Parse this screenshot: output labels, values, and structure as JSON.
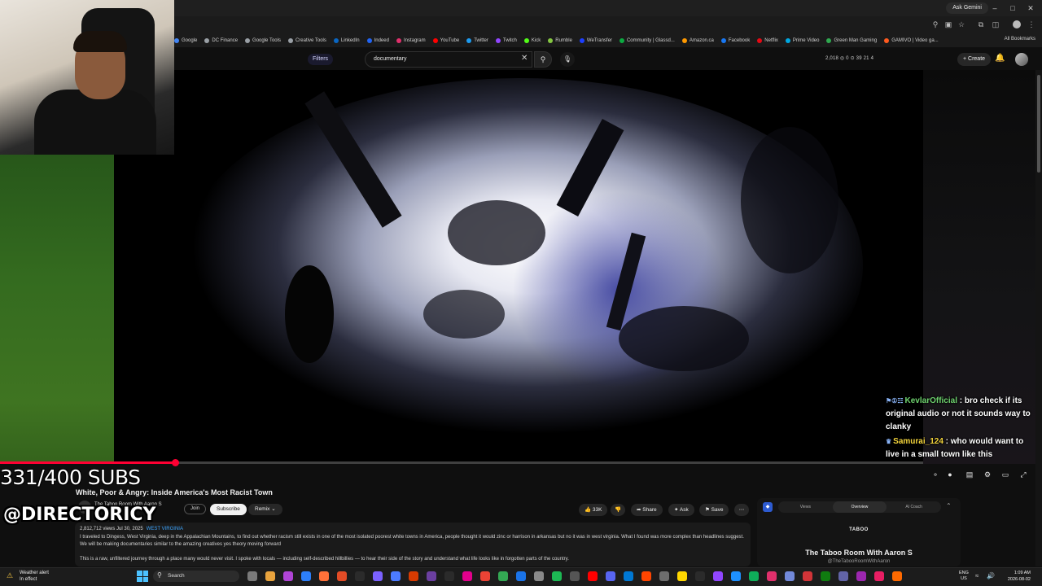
{
  "browser": {
    "ask_gemini": "Ask Gemini",
    "bookmarks": [
      "Google",
      "DC Finance",
      "Google Tools",
      "Creative Tools",
      "LinkedIn",
      "Indeed",
      "Instagram",
      "YouTube",
      "Twitter",
      "Twitch",
      "Kick",
      "Rumble",
      "WeTransfer",
      "Community | Glassd...",
      "Amazon.ca",
      "Facebook",
      "Netflix",
      "Prime Video",
      "Green Man Gaming",
      "GAMIVO | Video ga..."
    ],
    "bookmark_colors": [
      "#4285f4",
      "#9aa0a6",
      "#9aa0a6",
      "#9aa0a6",
      "#0a66c2",
      "#2164f3",
      "#e1306c",
      "#ff0000",
      "#1d9bf0",
      "#9146ff",
      "#53fc18",
      "#85c742",
      "#1c3fff",
      "#0caa41",
      "#ff9900",
      "#1877f2",
      "#e50914",
      "#00a8e1",
      "#2fa84f",
      "#ff5a1f"
    ],
    "all_bookmarks": "All Bookmarks"
  },
  "youtube": {
    "filters_label": "Filters",
    "search_value": "documentary",
    "stats_readout": "2,018  ◎ 0  ⊙ 39  21  4",
    "create_label": "+ Create"
  },
  "overlay": {
    "subs_counter": "331/400 SUBS",
    "handle": "@DIRECTORICY"
  },
  "chat": [
    {
      "user": "KevlarOfficial",
      "message": ": bro check if its original audio or not it sounds way to clanky",
      "badges": "⚑①☷",
      "color": "#6fd36f"
    },
    {
      "user": "Samurai_124",
      "message": ": who would want to live in a small town like this",
      "badges": "♛",
      "color": "#f2d33b"
    }
  ],
  "player": {
    "progress_fraction": 0.19
  },
  "video": {
    "title": "White, Poor & Angry: Inside America's Most Racist Town",
    "channel": "The Taboo Room With Aaron S",
    "join_label": "Join",
    "subscribe_label": "Subscribe",
    "remix_label": "Remix",
    "likes_label": "33K",
    "share_label": "Share",
    "ask_label": "Ask",
    "save_label": "Save",
    "more_label": "⋯",
    "views_line": "2,812,712 views  Jul 30, 2025",
    "location": "WEST VIRGINIA",
    "description_1": "I traveled to Dingess, West Virginia, deep in the Appalachian Mountains, to find out whether racism still exists in one of the most isolated poorest white towns in America, people thought it would zinc or harrison in arkansas but no it was in west virginia. What I found was more complex than headlines suggest. We will be making documentaries similar to the amazing creatives yes theory moving forward",
    "description_2": "This is a raw, unfiltered journey through a place many would never visit. I spoke with locals — including self-described hillbillies — to hear their side of the story and understand what life looks like in forgotten parts of the country."
  },
  "side_panel": {
    "tabs": [
      "Views",
      "Overview",
      "AI Coach"
    ],
    "active_tab": "Overview",
    "brand": "TABOO",
    "channel_name": "The Taboo Room With Aaron S",
    "handle": "@TheTabooRoomWithAaron"
  },
  "taskbar": {
    "weather_title": "Weather alert",
    "weather_sub": "In effect",
    "search_placeholder": "Search",
    "lang": "ENG",
    "region": "US",
    "time": "1:09 AM",
    "date": "2026-08-02",
    "app_colors": [
      "#7a7a7a",
      "#e8a33d",
      "#b044d6",
      "#2d7ff9",
      "#ff7139",
      "#e34c26",
      "#2b2b2b",
      "#7b61ff",
      "#4c7bff",
      "#d83b01",
      "#6b3fa0",
      "#2b2b2b",
      "#e3008c",
      "#ea4335",
      "#34a853",
      "#1a73e8",
      "#8a8a8a",
      "#1db954",
      "#555",
      "#ff0000",
      "#5865f2",
      "#0078d4",
      "#ff4500",
      "#6e6e6e",
      "#ffd700",
      "#2b2b2b",
      "#9146ff",
      "#1e90ff",
      "#0fae5a",
      "#e1306c",
      "#7289da",
      "#d13438",
      "#107c10",
      "#6264a7",
      "#9c27b0",
      "#e91e63",
      "#ff6a00"
    ]
  }
}
